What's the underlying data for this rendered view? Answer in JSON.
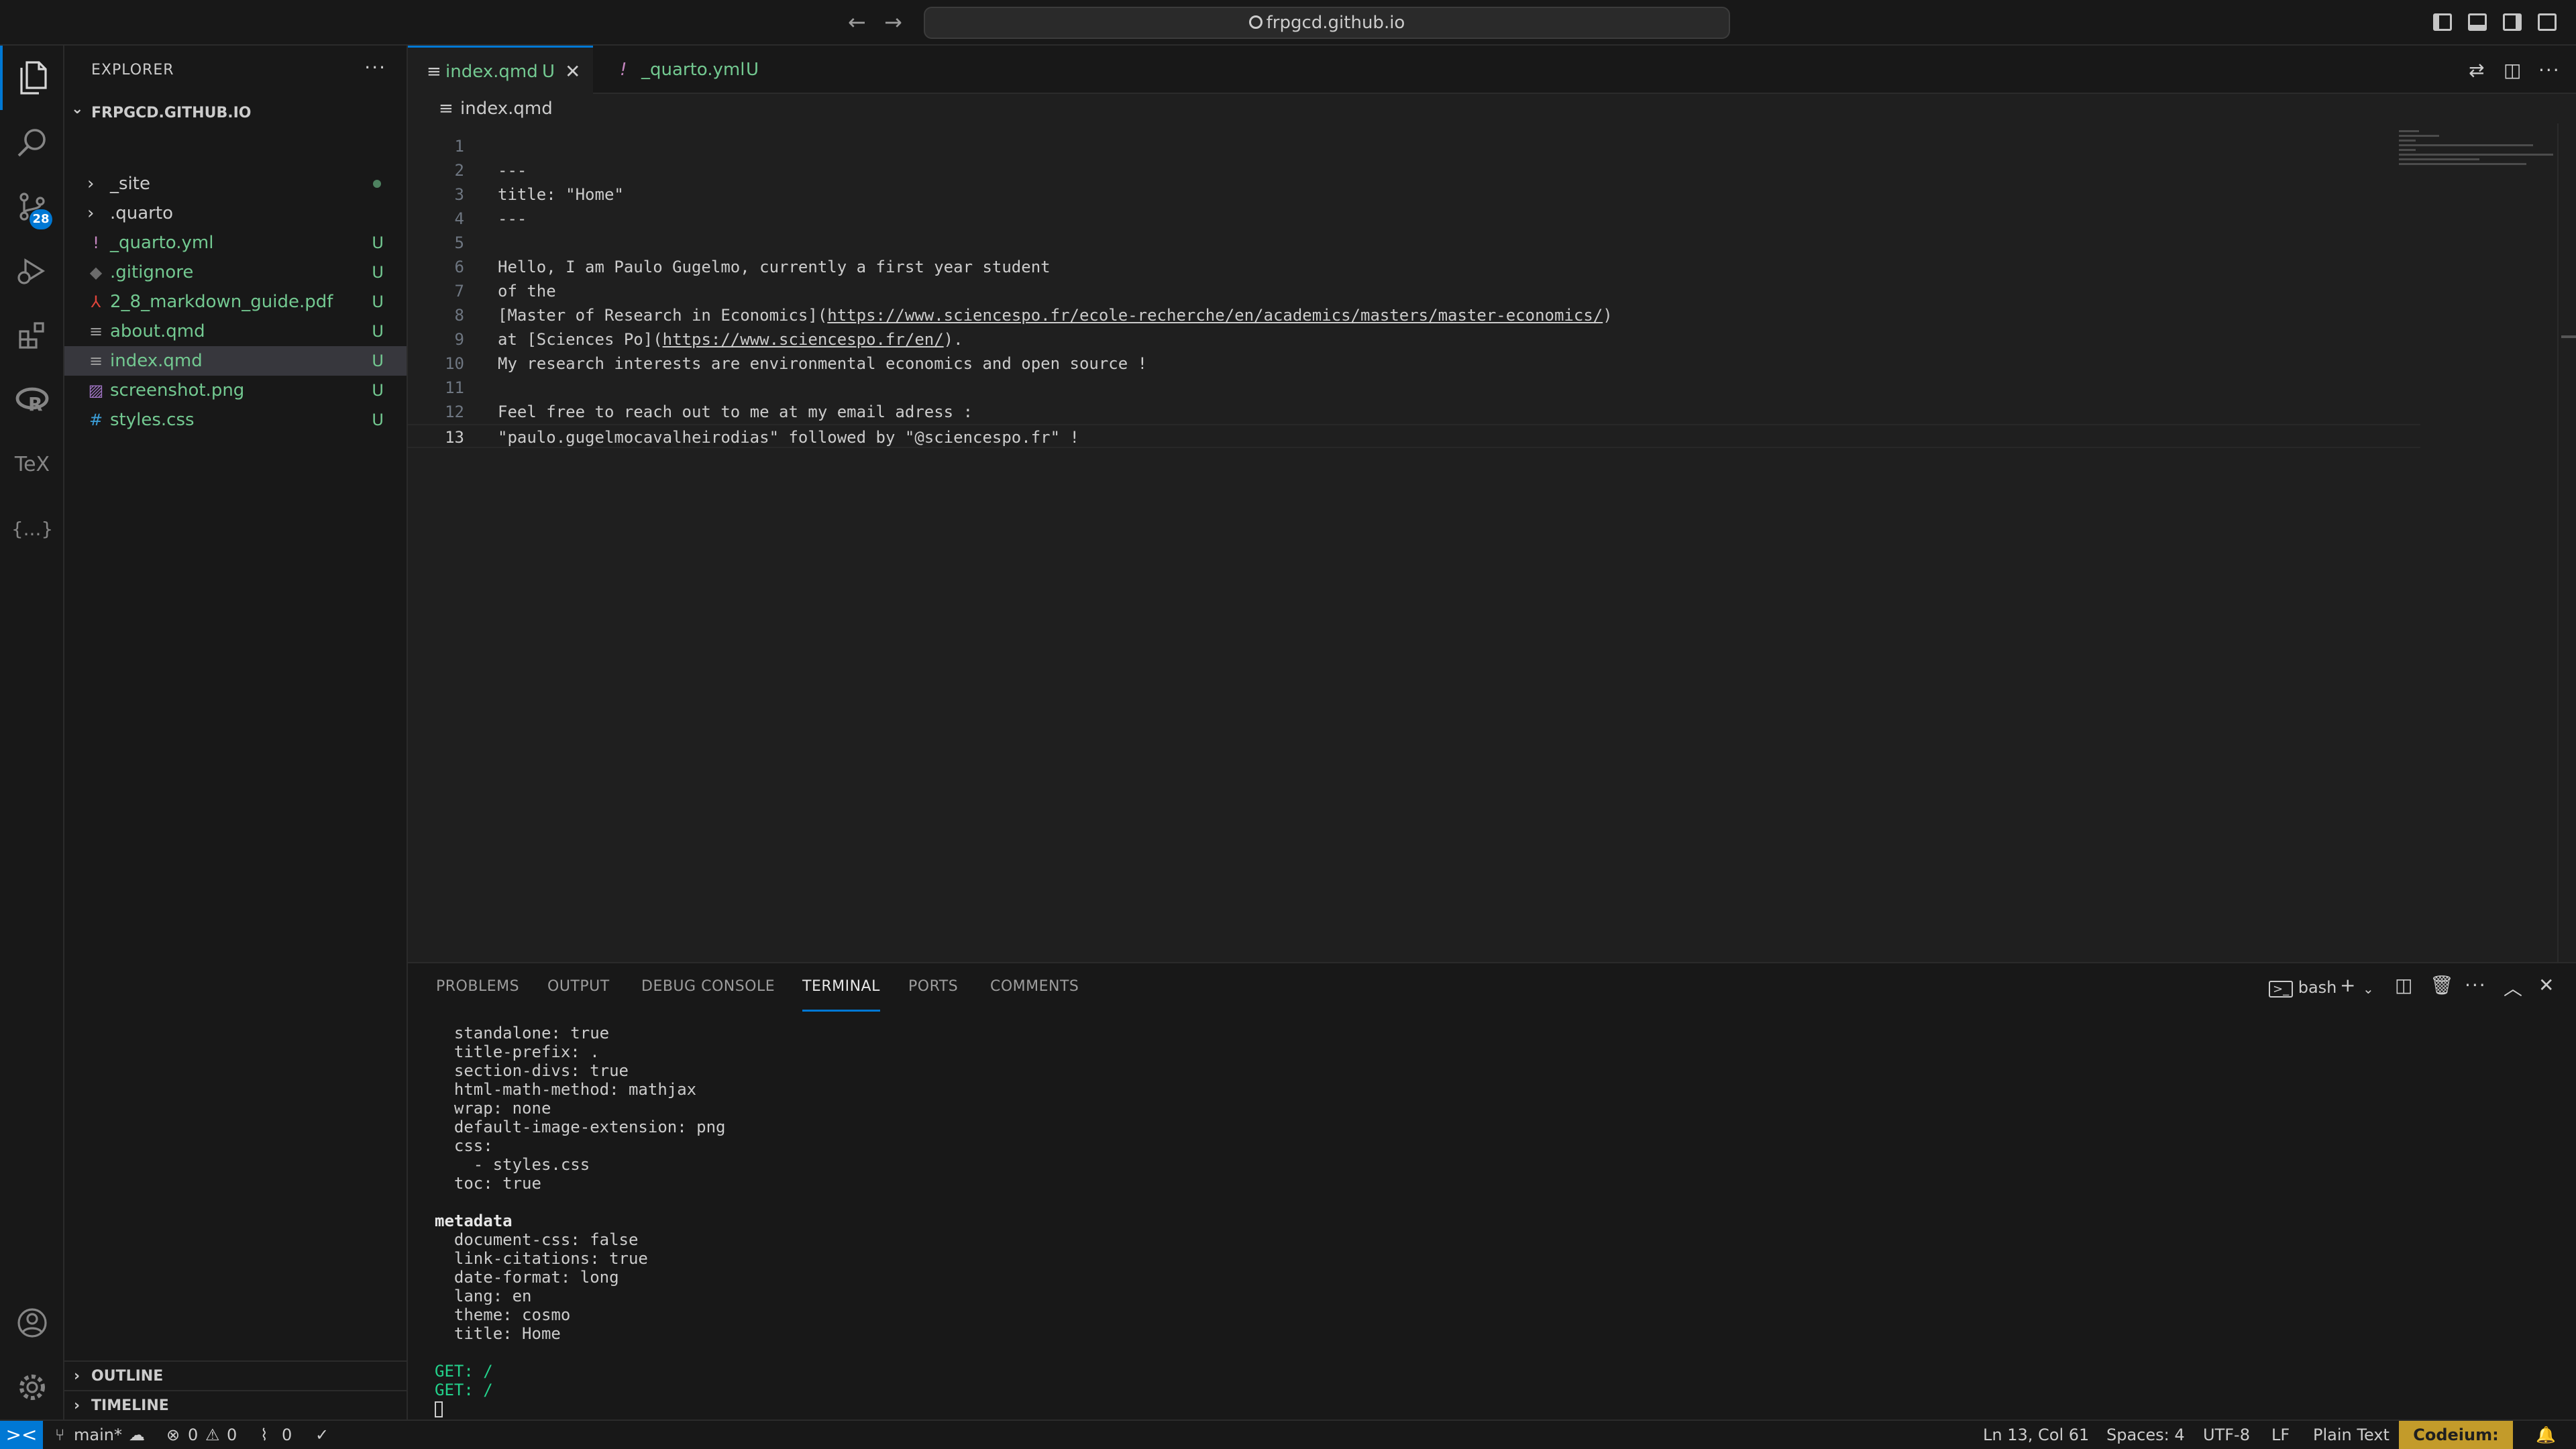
{
  "titlebar": {
    "search_text": "frpgcd.github.io",
    "back_glyph": "←",
    "forward_glyph": "→"
  },
  "activity": {
    "source_control_badge": "28",
    "tex_label": "TeX",
    "json_label": "{...}"
  },
  "sidebar": {
    "title": "EXPLORER",
    "more": "···",
    "folder": "FRPGCD.GITHUB.IO",
    "items": [
      {
        "label": "_site",
        "type": "folder",
        "status": "",
        "color": "#cccccc"
      },
      {
        "label": ".quarto",
        "type": "folder",
        "status": "",
        "color": "#cccccc"
      },
      {
        "label": "_quarto.yml",
        "type": "yml",
        "status": "U",
        "color": "#73c991",
        "icon": "!"
      },
      {
        "label": ".gitignore",
        "type": "git",
        "status": "U",
        "color": "#73c991",
        "icon": "◆"
      },
      {
        "label": "2_8_markdown_guide.pdf",
        "type": "pdf",
        "status": "U",
        "color": "#73c991",
        "icon": "⅄"
      },
      {
        "label": "about.qmd",
        "type": "qmd",
        "status": "U",
        "color": "#73c991",
        "icon": "≡"
      },
      {
        "label": "index.qmd",
        "type": "qmd",
        "status": "U",
        "color": "#73c991",
        "icon": "≡"
      },
      {
        "label": "screenshot.png",
        "type": "png",
        "status": "U",
        "color": "#73c991",
        "icon": "▨"
      },
      {
        "label": "styles.css",
        "type": "css",
        "status": "U",
        "color": "#73c991",
        "icon": "#"
      }
    ],
    "outline": "OUTLINE",
    "timeline": "TIMELINE"
  },
  "tabs": [
    {
      "label": "index.qmd",
      "status": "U",
      "icon": "≡"
    },
    {
      "label": "_quarto.yml",
      "status": "U",
      "icon": "!"
    }
  ],
  "breadcrumb": "index.qmd",
  "editor": {
    "current_line": 13,
    "lines": [
      {
        "n": "1",
        "text": ""
      },
      {
        "n": "2",
        "text": "---"
      },
      {
        "n": "3",
        "text": "title: \"Home\""
      },
      {
        "n": "4",
        "text": "---"
      },
      {
        "n": "5",
        "text": ""
      },
      {
        "n": "6",
        "text": "Hello, I am Paulo Gugelmo, currently a first year student"
      },
      {
        "n": "7",
        "text": "of the"
      },
      {
        "n": "8",
        "pre": "[Master of Research in Economics](",
        "link": "https://www.sciencespo.fr/ecole-recherche/en/academics/masters/master-economics/",
        "post": ")"
      },
      {
        "n": "9",
        "pre": "at [Sciences Po](",
        "link": "https://www.sciencespo.fr/en/",
        "post": ")."
      },
      {
        "n": "10",
        "text": "My research interests are environmental economics and open source !"
      },
      {
        "n": "11",
        "text": ""
      },
      {
        "n": "12",
        "text": "Feel free to reach out to me at my email adress :"
      },
      {
        "n": "13",
        "text": "\"paulo.gugelmocavalheirodias\" followed by \"@sciencespo.fr\" !"
      }
    ]
  },
  "panel": {
    "tabs": [
      "PROBLEMS",
      "OUTPUT",
      "DEBUG CONSOLE",
      "TERMINAL",
      "PORTS",
      "COMMENTS"
    ],
    "active_tab": "TERMINAL",
    "shell": "bash",
    "terminal_lines": [
      {
        "text": "  standalone: true",
        "style": ""
      },
      {
        "text": "  title-prefix: .",
        "style": ""
      },
      {
        "text": "  section-divs: true",
        "style": ""
      },
      {
        "text": "  html-math-method: mathjax",
        "style": ""
      },
      {
        "text": "  wrap: none",
        "style": ""
      },
      {
        "text": "  default-image-extension: png",
        "style": ""
      },
      {
        "text": "  css:",
        "style": ""
      },
      {
        "text": "    - styles.css",
        "style": ""
      },
      {
        "text": "  toc: true",
        "style": ""
      },
      {
        "text": "",
        "style": ""
      },
      {
        "text": "metadata",
        "style": "bold"
      },
      {
        "text": "  document-css: false",
        "style": ""
      },
      {
        "text": "  link-citations: true",
        "style": ""
      },
      {
        "text": "  date-format: long",
        "style": ""
      },
      {
        "text": "  lang: en",
        "style": ""
      },
      {
        "text": "  theme: cosmo",
        "style": ""
      },
      {
        "text": "  title: Home",
        "style": ""
      },
      {
        "text": "",
        "style": ""
      },
      {
        "text": "GET: /",
        "style": "green"
      },
      {
        "text": "GET: /",
        "style": "green"
      }
    ]
  },
  "statusbar": {
    "remote_glyph": "><",
    "branch": "main*",
    "errors": "0",
    "warnings": "0",
    "ports": "0",
    "cursor": "Ln 13, Col 61",
    "spaces": "Spaces: 4",
    "encoding": "UTF-8",
    "eol": "LF",
    "language": "Plain Text",
    "codeium": "Codeium: {...}",
    "accent": "#0078d4"
  }
}
